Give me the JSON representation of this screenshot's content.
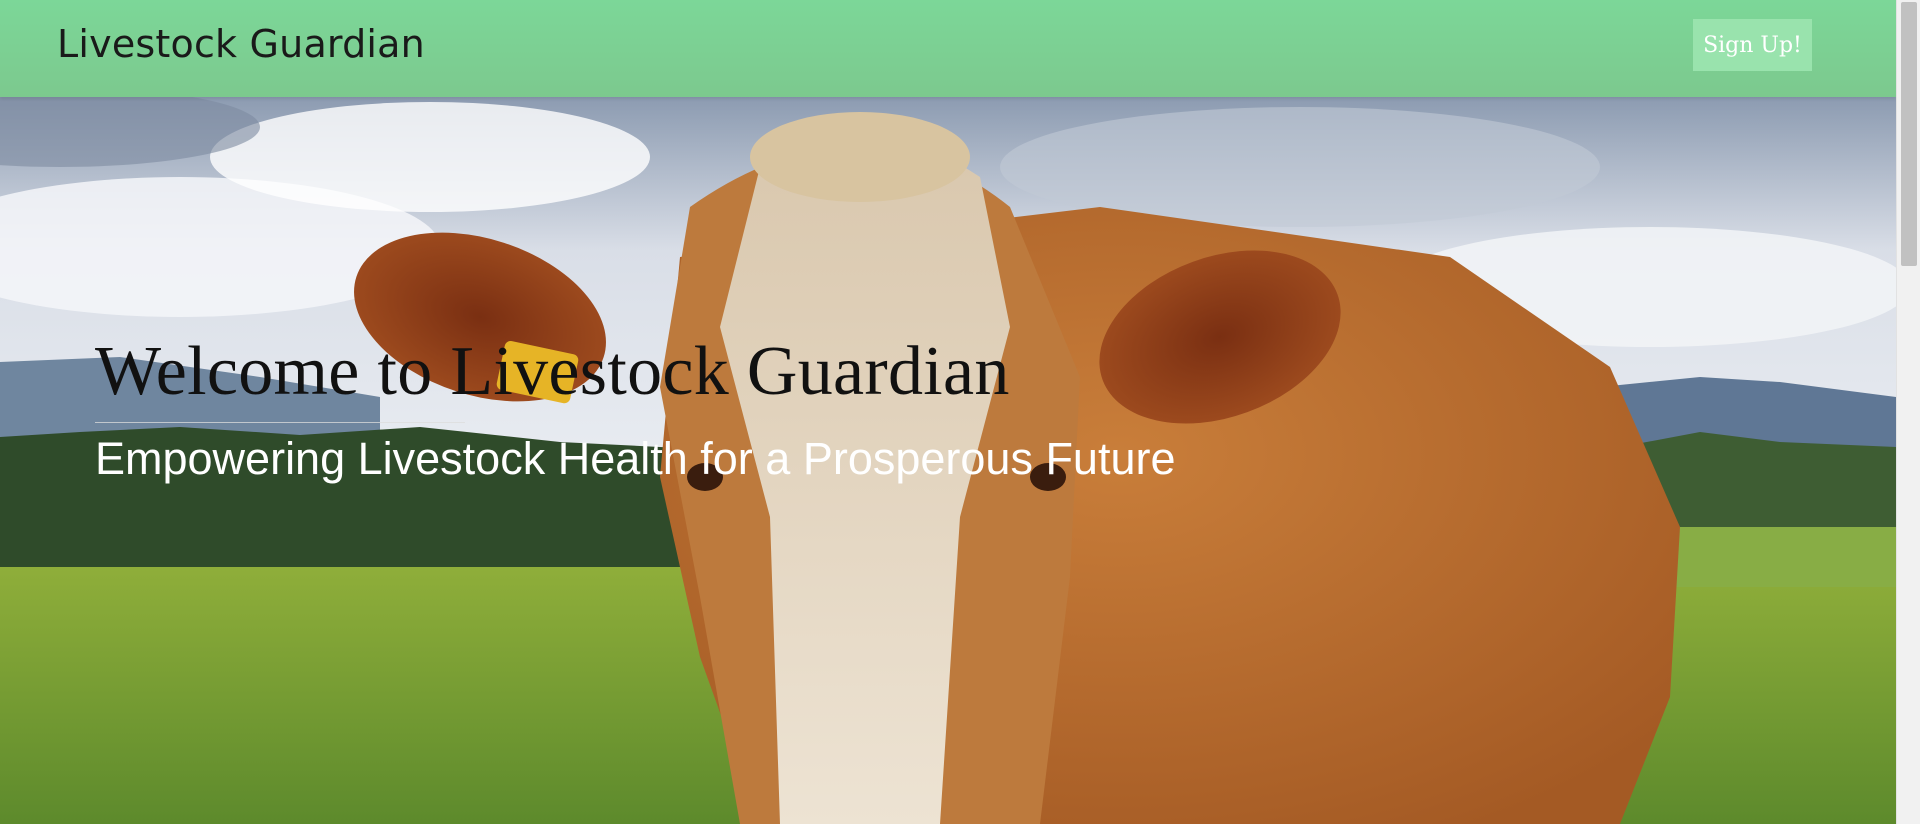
{
  "navbar": {
    "brand": "Livestock Guardian",
    "signup_label": "Sign Up!"
  },
  "hero": {
    "title": "Welcome to Livestock Guardian",
    "subtitle": "Empowering Livestock Health for a Prosperous Future",
    "background_image": "cow-in-pasture-photo"
  },
  "colors": {
    "navbar_bg": "#7cd798",
    "signup_bg": "#99e3ad",
    "signup_text": "#ffffff",
    "title_text": "#111111",
    "subtitle_text": "#ffffff"
  }
}
